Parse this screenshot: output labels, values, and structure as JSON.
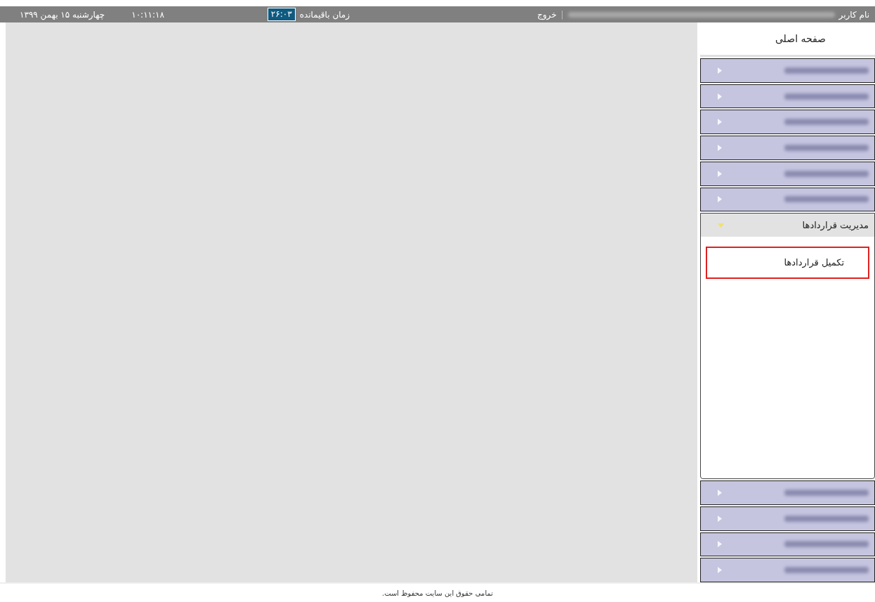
{
  "top_bar": {
    "user_label": "نام کاربر",
    "user_name_blurred": true,
    "separator": "|",
    "logout": "خروج",
    "remaining_label": "زمان باقیمانده",
    "remaining_time": "۲۶:۰۳",
    "time": "۱۰:۱۱:۱۸",
    "date": "چهارشنبه ۱۵ بهمن ۱۳۹۹"
  },
  "sidebar": {
    "home": "صفحه اصلی",
    "items": [
      {
        "blurred": true,
        "expanded": false
      },
      {
        "blurred": true,
        "expanded": false
      },
      {
        "blurred": true,
        "expanded": false
      },
      {
        "blurred": true,
        "expanded": false
      },
      {
        "blurred": true,
        "expanded": false
      },
      {
        "blurred": true,
        "expanded": false
      },
      {
        "label": "مدیریت قراردادها",
        "expanded": true,
        "children": [
          {
            "label": "تکمیل قراردادها",
            "selected": true
          }
        ]
      },
      {
        "blurred": true,
        "expanded": false
      },
      {
        "blurred": true,
        "expanded": false
      },
      {
        "blurred": true,
        "expanded": false
      },
      {
        "blurred": true,
        "expanded": false
      }
    ]
  },
  "footer": {
    "text": "تمامی حقوق این سایت محفوظ است."
  }
}
